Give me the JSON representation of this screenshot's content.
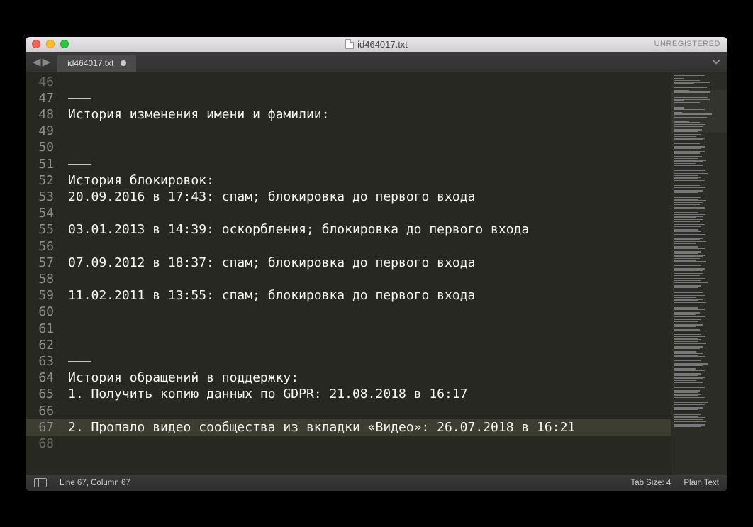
{
  "titlebar": {
    "filename": "id464017.txt",
    "registered": "UNREGISTERED"
  },
  "tabs": {
    "active": {
      "label": "id464017.txt",
      "dirty": true
    }
  },
  "editor": {
    "lines": [
      {
        "n": 46,
        "text": "",
        "cut": true
      },
      {
        "n": 47,
        "text": "———"
      },
      {
        "n": 48,
        "text": "История изменения имени и фамилии:"
      },
      {
        "n": 49,
        "text": ""
      },
      {
        "n": 50,
        "text": ""
      },
      {
        "n": 51,
        "text": "———"
      },
      {
        "n": 52,
        "text": "История блокировок:"
      },
      {
        "n": 53,
        "text": "20.09.2016 в 17:43: спам; блокировка до первого входа"
      },
      {
        "n": 54,
        "text": ""
      },
      {
        "n": 55,
        "text": "03.01.2013 в 14:39: оскорбления; блокировка до первого входа"
      },
      {
        "n": 56,
        "text": ""
      },
      {
        "n": 57,
        "text": "07.09.2012 в 18:37: спам; блокировка до первого входа"
      },
      {
        "n": 58,
        "text": ""
      },
      {
        "n": 59,
        "text": "11.02.2011 в 13:55: спам; блокировка до первого входа"
      },
      {
        "n": 60,
        "text": ""
      },
      {
        "n": 61,
        "text": ""
      },
      {
        "n": 62,
        "text": ""
      },
      {
        "n": 63,
        "text": "———"
      },
      {
        "n": 64,
        "text": "История обращений в поддержку:"
      },
      {
        "n": 65,
        "text": "1. Получить копию данных по GDPR: 21.08.2018 в 16:17"
      },
      {
        "n": 66,
        "text": ""
      },
      {
        "n": 67,
        "text": "2. Пропало видео сообщества из вкладки «Видео»: 26.07.2018 в 16:21",
        "highlight": true
      },
      {
        "n": 68,
        "text": "",
        "cut": true
      }
    ]
  },
  "statusbar": {
    "position": "Line 67, Column 67",
    "tabsize": "Tab Size: 4",
    "syntax": "Plain Text"
  }
}
